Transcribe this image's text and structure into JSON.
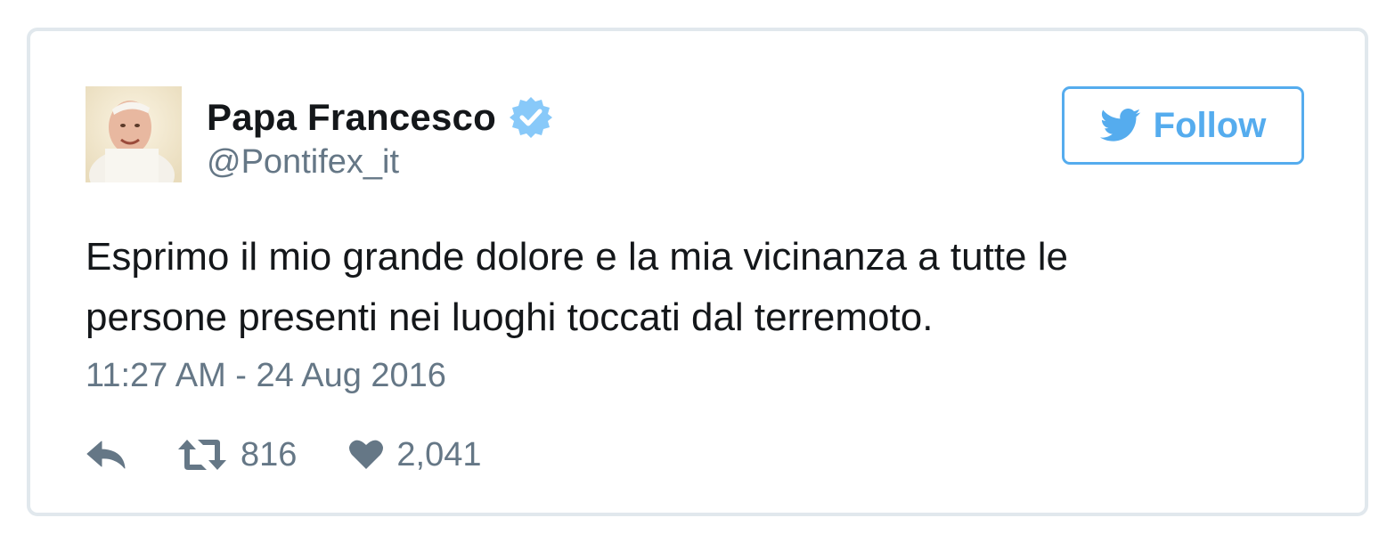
{
  "tweet": {
    "author": {
      "display_name": "Papa Francesco",
      "handle": "@Pontifex_it",
      "verified": true,
      "avatar": "avatar-portrait"
    },
    "follow_button": {
      "label": "Follow",
      "icon": "twitter-bird-icon"
    },
    "text_lines": [
      "Esprimo il mio grande dolore e la mia vicinanza a tutte le",
      "persone presenti nei luoghi toccati dal terremoto."
    ],
    "timestamp": "11:27 AM - 24 Aug 2016",
    "actions": {
      "reply_icon": "reply-icon",
      "retweet_icon": "retweet-icon",
      "retweet_count": "816",
      "like_icon": "heart-icon",
      "like_count": "2,041"
    }
  },
  "colors": {
    "accent": "#55acee",
    "verified": "#88c9f9",
    "text_primary": "#14171a",
    "text_secondary": "#657786",
    "border": "#e1e8ed"
  }
}
